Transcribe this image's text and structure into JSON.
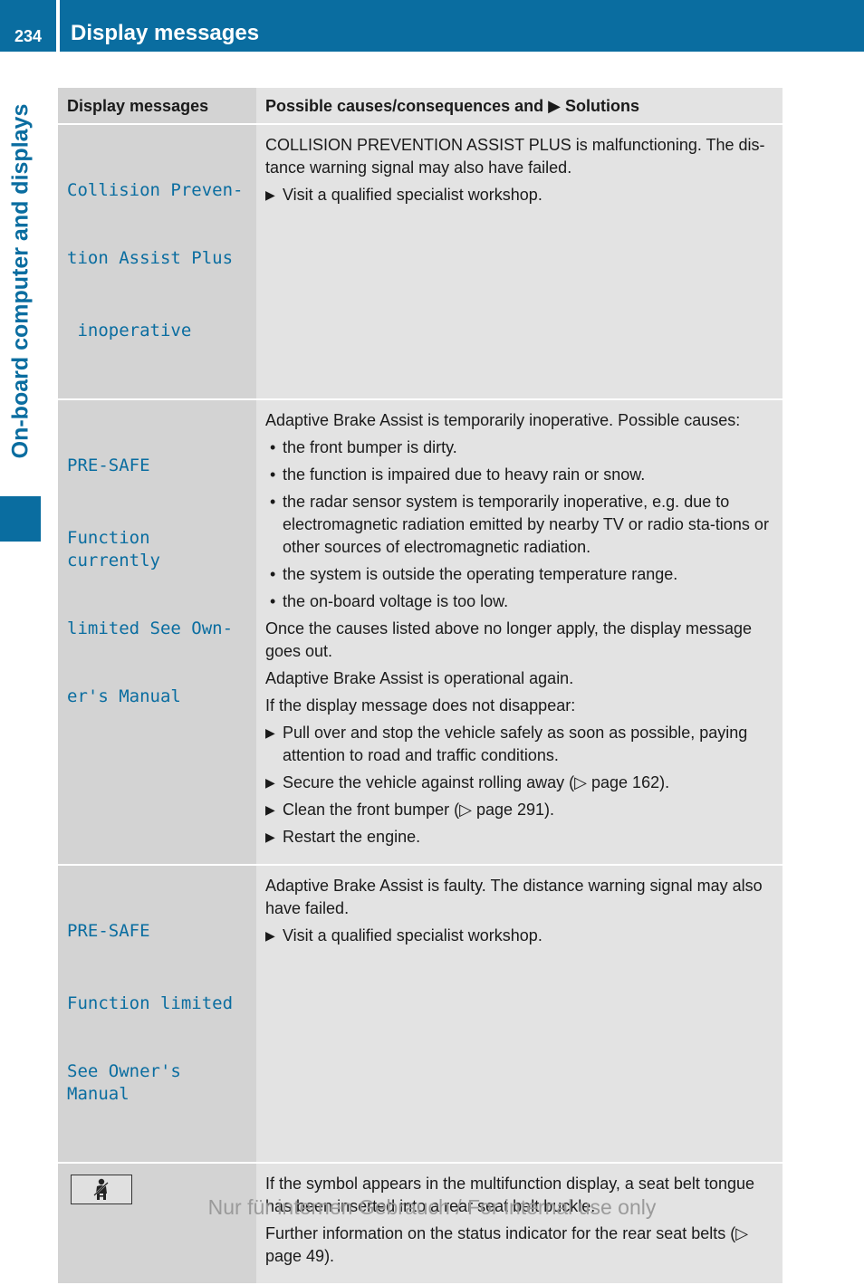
{
  "header": {
    "page_number": "234",
    "title": "Display messages"
  },
  "side_tab": {
    "label": "On-board computer and displays"
  },
  "colors": {
    "brand_blue": "#0a6da0",
    "cell_dark": "#d3d3d3",
    "cell_light": "#e3e3e3"
  },
  "table": {
    "headers": {
      "col1": "Display messages",
      "col2": "Possible causes/consequences and ▶ Solutions"
    },
    "rows": [
      {
        "message_lines": [
          "Collision Preven-",
          "tion Assist Plus",
          " inoperative"
        ],
        "content": {
          "p1": "COLLISION PREVENTION ASSIST PLUS is malfunctioning. The dis-tance warning signal may also have failed.",
          "step1": "Visit a qualified specialist workshop."
        }
      },
      {
        "message_lines": [
          "PRE-SAFE",
          "Function currently",
          "limited See Own-",
          "er's Manual"
        ],
        "content": {
          "p1": "Adaptive Brake Assist is temporarily inoperative. Possible causes:",
          "bullets": [
            "the front bumper is dirty.",
            "the function is impaired due to heavy rain or snow.",
            "the radar sensor system is temporarily inoperative, e.g. due to electromagnetic radiation emitted by nearby TV or radio sta-tions or other sources of electromagnetic radiation.",
            "the system is outside the operating temperature range.",
            "the on-board voltage is too low."
          ],
          "p2": "Once the causes listed above no longer apply, the display message goes out.",
          "p3": "Adaptive Brake Assist is operational again.",
          "p4": "If the display message does not disappear:",
          "steps": [
            "Pull over and stop the vehicle safely as soon as possible, paying attention to road and traffic conditions.",
            "Secure the vehicle against rolling away (▷ page 162).",
            "Clean the front bumper (▷ page 291).",
            "Restart the engine."
          ]
        }
      },
      {
        "message_lines": [
          "PRE-SAFE",
          "Function limited",
          "See Owner's Manual"
        ],
        "content": {
          "p1": "Adaptive Brake Assist is faulty. The distance warning signal may also have failed.",
          "step1": "Visit a qualified specialist workshop."
        }
      },
      {
        "icon": "rear-seat-belt-icon",
        "content": {
          "p1": "If the symbol appears in the multifunction display, a seat belt tongue has been inserted into a rear seat belt buckle.",
          "p2": "Further information on the status indicator for the rear seat belts (▷ page 49)."
        }
      }
    ]
  },
  "footer": {
    "text": "Nur für internen Gebrauch / For internal use only"
  },
  "glyphs": {
    "step_marker": "▶"
  }
}
